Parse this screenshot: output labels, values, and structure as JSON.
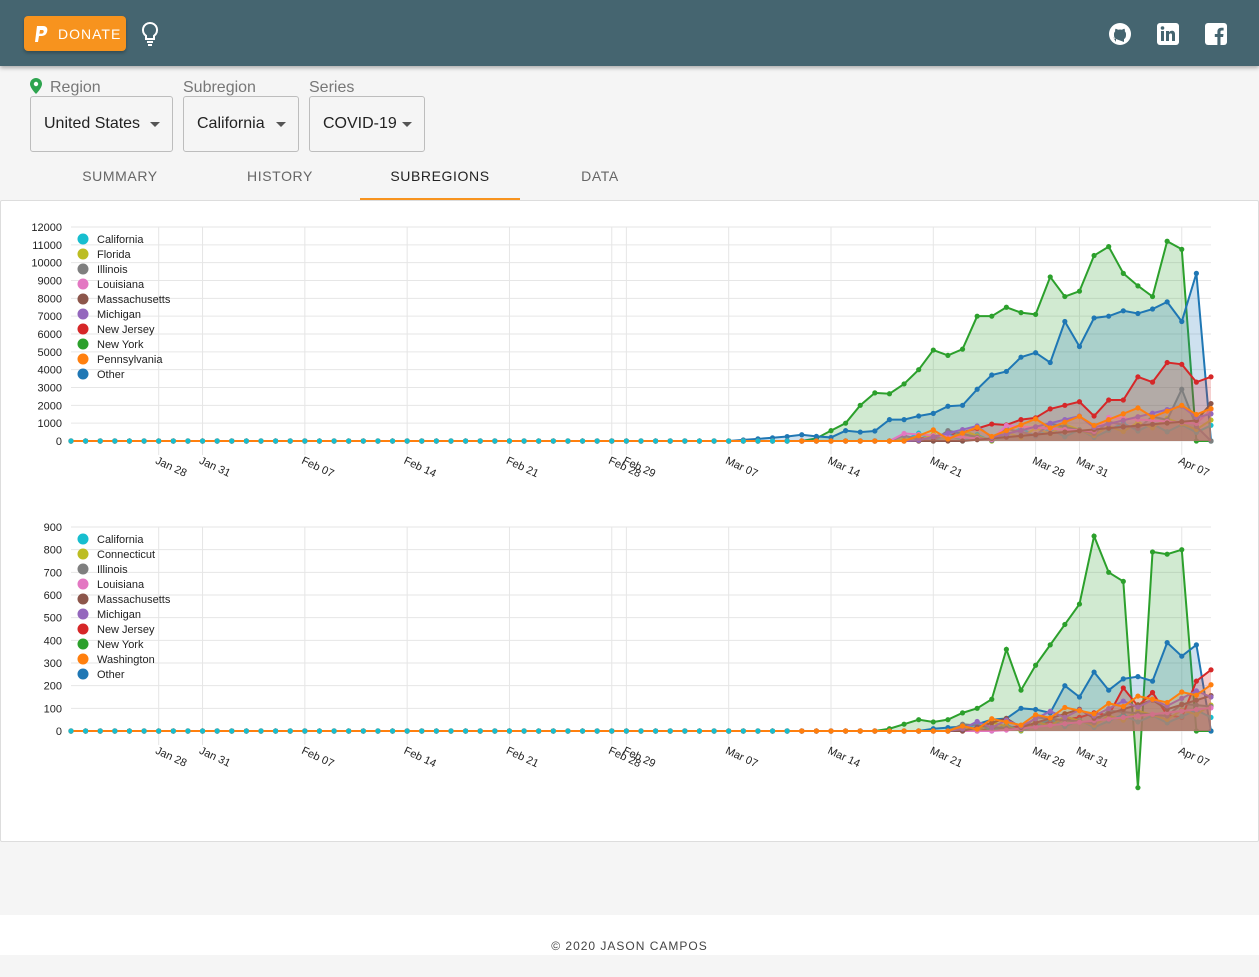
{
  "appbar": {
    "donate_label": "DONATE"
  },
  "selectors": {
    "region_label": "Region",
    "region_value": "United States",
    "subregion_label": "Subregion",
    "subregion_value": "California",
    "series_label": "Series",
    "series_value": "COVID-19"
  },
  "tabs": [
    {
      "label": "SUMMARY"
    },
    {
      "label": "HISTORY"
    },
    {
      "label": "SUBREGIONS",
      "active": true
    },
    {
      "label": "DATA"
    }
  ],
  "footer": {
    "text": "© 2020 JASON CAMPOS"
  },
  "colors": {
    "appbar": "#456570",
    "accent": "#f7931e"
  },
  "chart_data": [
    {
      "type": "area",
      "title": "",
      "x_start": "2020-01-22",
      "x_end": "2020-04-07",
      "xticks": [
        "Jan 28",
        "Jan 31",
        "Feb 07",
        "Feb 14",
        "Feb 21",
        "Feb 28",
        "Feb 29",
        "Mar 07",
        "Mar 14",
        "Mar 21",
        "Mar 28",
        "Mar 31",
        "Apr 07"
      ],
      "yticks": [
        "0",
        "1000",
        "2000",
        "3000",
        "4000",
        "5000",
        "6000",
        "7000",
        "8000",
        "9000",
        "10000",
        "11000",
        "12000"
      ],
      "ylim": [
        0,
        12000
      ],
      "legend": "top-left",
      "series": [
        {
          "name": "California",
          "color": "#17becf",
          "values": []
        },
        {
          "name": "Florida",
          "color": "#bcbd22",
          "values": []
        },
        {
          "name": "Illinois",
          "color": "#7f7f7f",
          "values": []
        },
        {
          "name": "Louisiana",
          "color": "#e377c2",
          "values": []
        },
        {
          "name": "Massachusetts",
          "color": "#8c564b",
          "values": []
        },
        {
          "name": "Michigan",
          "color": "#9467bd",
          "values": []
        },
        {
          "name": "New Jersey",
          "color": "#d62728",
          "values": []
        },
        {
          "name": "New York",
          "color": "#2ca02c",
          "values": []
        },
        {
          "name": "Pennsylvania",
          "color": "#ff7f0e",
          "values": []
        },
        {
          "name": "Other",
          "color": "#1f77b4",
          "values": []
        }
      ]
    },
    {
      "type": "area",
      "title": "",
      "x_start": "2020-01-22",
      "x_end": "2020-04-07",
      "xticks": [
        "Jan 28",
        "Jan 31",
        "Feb 07",
        "Feb 14",
        "Feb 21",
        "Feb 28",
        "Feb 29",
        "Mar 07",
        "Mar 14",
        "Mar 21",
        "Mar 28",
        "Mar 31",
        "Apr 07"
      ],
      "yticks": [
        "0",
        "100",
        "200",
        "300",
        "400",
        "500",
        "600",
        "700",
        "800",
        "900"
      ],
      "ylim": [
        -250,
        900
      ],
      "legend": "top-left",
      "series": [
        {
          "name": "California",
          "color": "#17becf",
          "values": []
        },
        {
          "name": "Connecticut",
          "color": "#bcbd22",
          "values": []
        },
        {
          "name": "Illinois",
          "color": "#7f7f7f",
          "values": []
        },
        {
          "name": "Louisiana",
          "color": "#e377c2",
          "values": []
        },
        {
          "name": "Massachusetts",
          "color": "#8c564b",
          "values": []
        },
        {
          "name": "Michigan",
          "color": "#9467bd",
          "values": []
        },
        {
          "name": "New Jersey",
          "color": "#d62728",
          "values": []
        },
        {
          "name": "New York",
          "color": "#2ca02c",
          "values": []
        },
        {
          "name": "Washington",
          "color": "#ff7f0e",
          "values": []
        },
        {
          "name": "Other",
          "color": "#1f77b4",
          "values": []
        }
      ]
    }
  ]
}
